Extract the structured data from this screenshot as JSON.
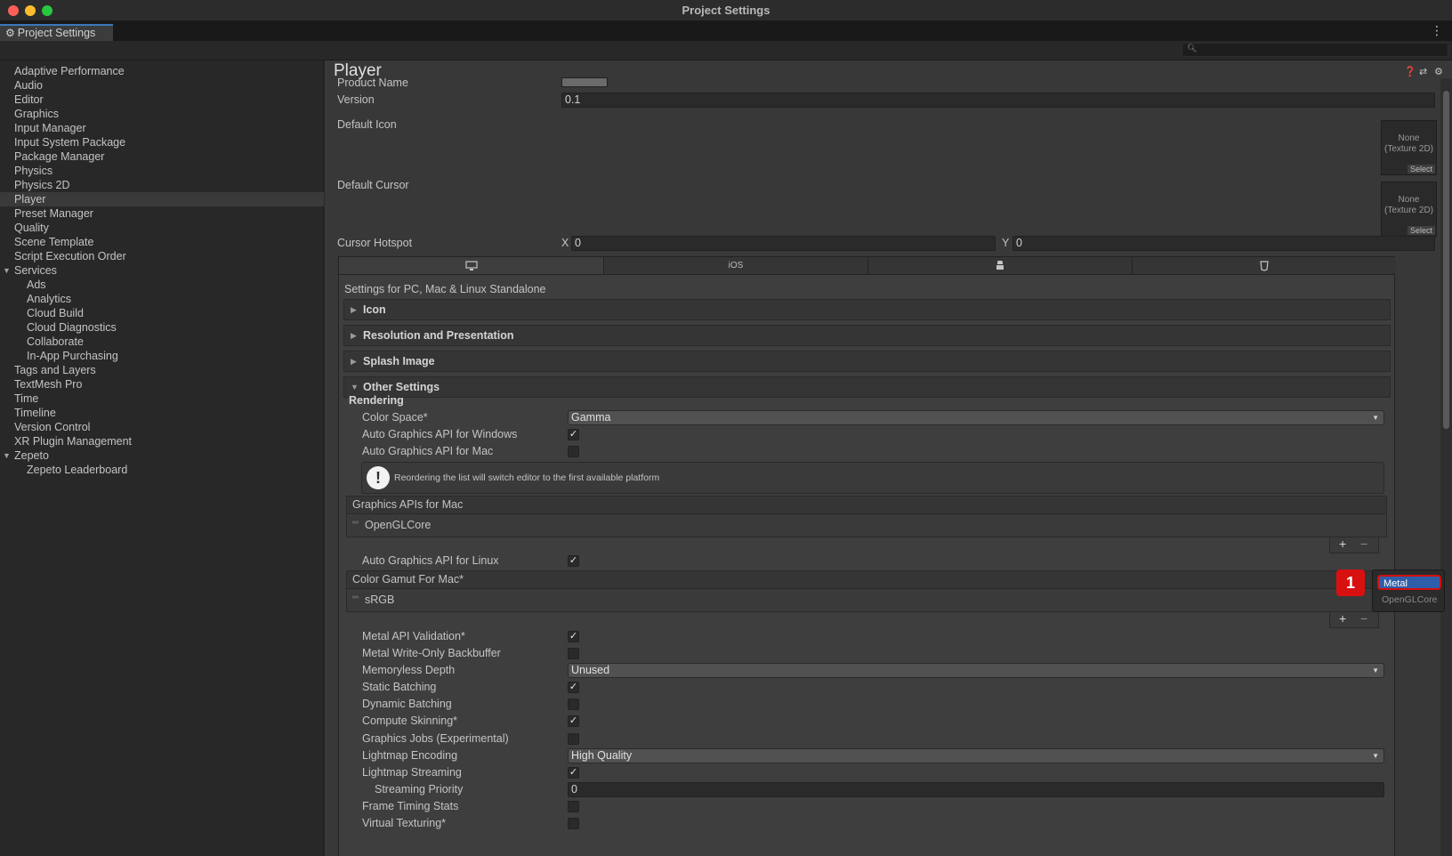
{
  "window": {
    "title": "Project Settings"
  },
  "tab": {
    "label": "Project Settings"
  },
  "sidebar": {
    "items": [
      {
        "label": "Adaptive Performance"
      },
      {
        "label": "Audio"
      },
      {
        "label": "Editor"
      },
      {
        "label": "Graphics"
      },
      {
        "label": "Input Manager"
      },
      {
        "label": "Input System Package"
      },
      {
        "label": "Package Manager"
      },
      {
        "label": "Physics"
      },
      {
        "label": "Physics 2D"
      },
      {
        "label": "Player"
      },
      {
        "label": "Preset Manager"
      },
      {
        "label": "Quality"
      },
      {
        "label": "Scene Template"
      },
      {
        "label": "Script Execution Order"
      },
      {
        "label": "Services"
      },
      {
        "label": "Ads"
      },
      {
        "label": "Analytics"
      },
      {
        "label": "Cloud Build"
      },
      {
        "label": "Cloud Diagnostics"
      },
      {
        "label": "Collaborate"
      },
      {
        "label": "In-App Purchasing"
      },
      {
        "label": "Tags and Layers"
      },
      {
        "label": "TextMesh Pro"
      },
      {
        "label": "Time"
      },
      {
        "label": "Timeline"
      },
      {
        "label": "Version Control"
      },
      {
        "label": "XR Plugin Management"
      },
      {
        "label": "Zepeto"
      },
      {
        "label": "Zepeto Leaderboard"
      }
    ],
    "selected": "Player"
  },
  "player": {
    "title": "Player",
    "product_name_label": "Product Name",
    "version_label": "Version",
    "version_value": "0.1",
    "default_icon_label": "Default Icon",
    "default_cursor_label": "Default Cursor",
    "texture_none": "None\n(Texture 2D)",
    "select_label": "Select",
    "cursor_hotspot_label": "Cursor Hotspot",
    "hotspot_x_label": "X",
    "hotspot_x_value": "0",
    "hotspot_y_label": "Y",
    "hotspot_y_value": "0"
  },
  "platform_tabs": {
    "ios_label": "iOS",
    "settings_for": "Settings for PC, Mac & Linux Standalone"
  },
  "sections": {
    "icon": "Icon",
    "resolution": "Resolution and Presentation",
    "splash": "Splash Image",
    "other": "Other Settings"
  },
  "rendering": {
    "header": "Rendering",
    "color_space_label": "Color Space*",
    "color_space_value": "Gamma",
    "auto_api_windows_label": "Auto Graphics API  for Windows",
    "auto_api_mac_label": "Auto Graphics API  for Mac",
    "help_text": "Reordering the list will switch editor to the first available platform",
    "apis_mac_header": "Graphics APIs for Mac",
    "apis_mac_item": "OpenGLCore",
    "auto_api_linux_label": "Auto Graphics API  for Linux",
    "gamut_header": "Color Gamut For Mac*",
    "gamut_item": "sRGB",
    "metal_validation_label": "Metal API Validation*",
    "metal_writeonly_label": "Metal Write-Only Backbuffer",
    "memoryless_label": "Memoryless Depth",
    "memoryless_value": "Unused",
    "static_batching_label": "Static Batching",
    "dynamic_batching_label": "Dynamic Batching",
    "compute_skinning_label": "Compute Skinning*",
    "graphics_jobs_label": "Graphics Jobs (Experimental)",
    "lightmap_encoding_label": "Lightmap Encoding",
    "lightmap_encoding_value": "High Quality",
    "lightmap_streaming_label": "Lightmap Streaming",
    "streaming_priority_label": "Streaming Priority",
    "streaming_priority_value": "0",
    "frame_timing_label": "Frame Timing Stats",
    "virtual_texturing_label": "Virtual Texturing*"
  },
  "popup": {
    "option_metal": "Metal",
    "option_openglcore": "OpenGLCore"
  },
  "annotation": {
    "badge": "1"
  }
}
